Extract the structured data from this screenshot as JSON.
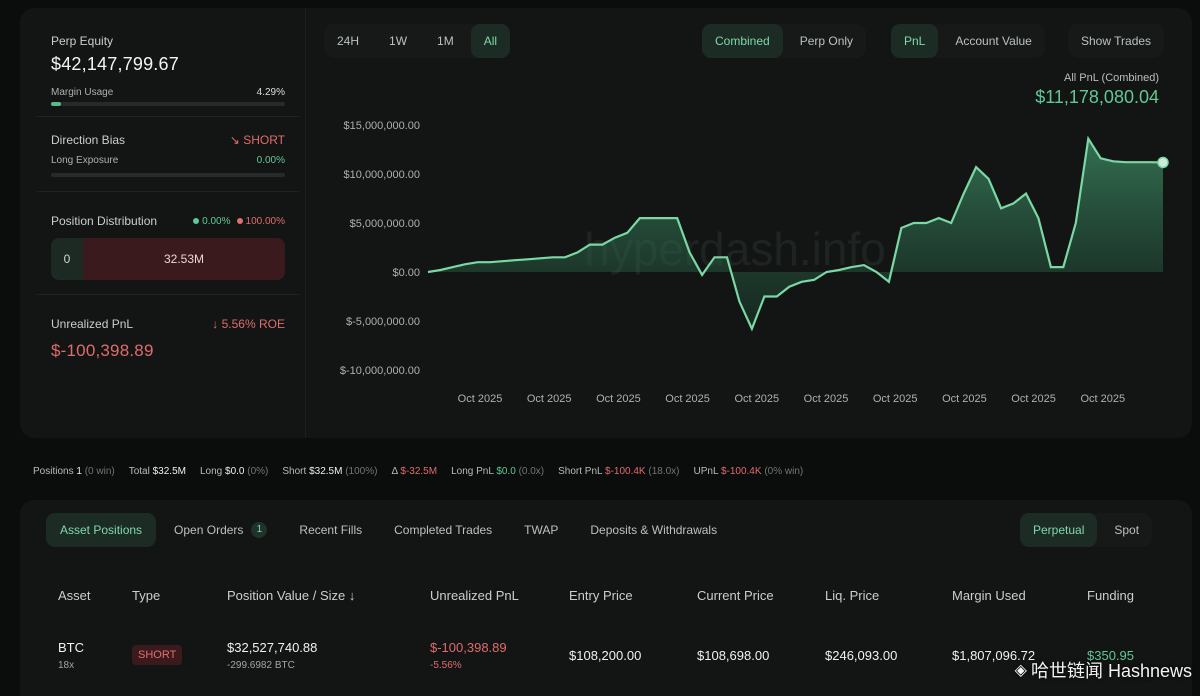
{
  "left": {
    "perp_equity_label": "Perp Equity",
    "perp_equity_value": "$42,147,799.67",
    "margin_usage_label": "Margin Usage",
    "margin_usage_value": "4.29%",
    "margin_usage_fraction": 0.0429,
    "direction_bias_label": "Direction Bias",
    "direction_bias_value": "SHORT",
    "long_exposure_label": "Long Exposure",
    "long_exposure_value": "0.00%",
    "long_exposure_fraction": 0.0,
    "position_distribution_label": "Position Distribution",
    "dist_long_pct": "0.00%",
    "dist_short_pct": "100.00%",
    "dist_long_value": "0",
    "dist_short_value": "32.53M",
    "unrealized_pnl_label": "Unrealized PnL",
    "unrealized_roe": "5.56% ROE",
    "unrealized_pnl_value": "$-100,398.89"
  },
  "range_tabs": [
    "24H",
    "1W",
    "1M",
    "All"
  ],
  "range_active": "All",
  "mode_tabs": [
    "Combined",
    "Perp Only"
  ],
  "mode_active": "Combined",
  "metric_tabs": [
    "PnL",
    "Account Value"
  ],
  "metric_active": "PnL",
  "show_trades_label": "Show Trades",
  "pnl_header": {
    "title": "All PnL (Combined)",
    "value": "$11,178,080.04"
  },
  "chart_data": {
    "type": "area",
    "y_ticks": [
      "$15,000,000.00",
      "$10,000,000.00",
      "$5,000,000.00",
      "$0.00",
      "$-5,000,000.00",
      "$-10,000,000.00"
    ],
    "x_ticks": [
      "Oct 2025",
      "Oct 2025",
      "Oct 2025",
      "Oct 2025",
      "Oct 2025",
      "Oct 2025",
      "Oct 2025",
      "Oct 2025",
      "Oct 2025",
      "Oct 2025"
    ],
    "ylim": [
      -10000000,
      15000000
    ],
    "series": [
      {
        "values": [
          0,
          200000,
          500000,
          800000,
          1000000,
          1000000,
          1100000,
          1200000,
          1300000,
          1400000,
          1500000,
          1500000,
          2000000,
          2800000,
          2800000,
          3500000,
          4000000,
          5500000,
          5500000,
          5500000,
          5500000,
          2000000,
          -300000,
          1500000,
          1500000,
          -3000000,
          -5800000,
          -2500000,
          -2500000,
          -1500000,
          -1000000,
          -800000,
          0,
          200000,
          500000,
          700000,
          0,
          -1000000,
          4500000,
          5000000,
          5000000,
          5500000,
          5000000,
          8000000,
          10700000,
          9500000,
          6500000,
          7000000,
          8000000,
          5500000,
          500000,
          500000,
          5000000,
          13600000,
          11600000,
          11300000,
          11200000,
          11200000,
          11200000,
          11178080
        ]
      }
    ],
    "watermark": "hyperdash.info",
    "grid": false
  },
  "stats_bar": {
    "positions_label": "Positions",
    "positions_value": "1",
    "positions_win": "(0 win)",
    "total_label": "Total",
    "total_value": "$32.5M",
    "long_label": "Long",
    "long_value": "$0.0",
    "long_pct": "(0%)",
    "short_label": "Short",
    "short_value": "$32.5M",
    "short_pct": "(100%)",
    "delta_label": "Δ",
    "delta_value": "$-32.5M",
    "long_pnl_label": "Long PnL",
    "long_pnl_value": "$0.0",
    "long_pnl_x": "(0.0x)",
    "short_pnl_label": "Short PnL",
    "short_pnl_value": "$-100.4K",
    "short_pnl_x": "(18.0x)",
    "upnl_label": "UPnL",
    "upnl_value": "$-100.4K",
    "upnl_win": "(0% win)"
  },
  "bottom_tabs": [
    "Asset Positions",
    "Open Orders",
    "Recent Fills",
    "Completed Trades",
    "TWAP",
    "Deposits & Withdrawals"
  ],
  "bottom_tab_active": "Asset Positions",
  "open_orders_count": "1",
  "market_tabs": [
    "Perpetual",
    "Spot"
  ],
  "market_active": "Perpetual",
  "table": {
    "headers": [
      "Asset",
      "Type",
      "Position Value / Size",
      "Unrealized PnL",
      "Entry Price",
      "Current Price",
      "Liq. Price",
      "Margin Used",
      "Funding"
    ],
    "sort_icon": "arrow-down-icon",
    "row": {
      "asset": "BTC",
      "leverage": "18x",
      "type": "SHORT",
      "position_value": "$32,527,740.88",
      "position_size": "-299.6982 BTC",
      "unrealized_pnl": "$-100,398.89",
      "unrealized_pct": "-5.56%",
      "entry_price": "$108,200.00",
      "current_price": "$108,698.00",
      "liq_price": "$246,093.00",
      "margin_used": "$1,807,096.72",
      "funding": "$350.95"
    }
  },
  "watermark_brand": "哈世链闻 Hashnews",
  "colors": {
    "accent": "#5fc893",
    "negative": "#e06b6b",
    "panel": "#131515",
    "bg": "#0b0c0c"
  }
}
